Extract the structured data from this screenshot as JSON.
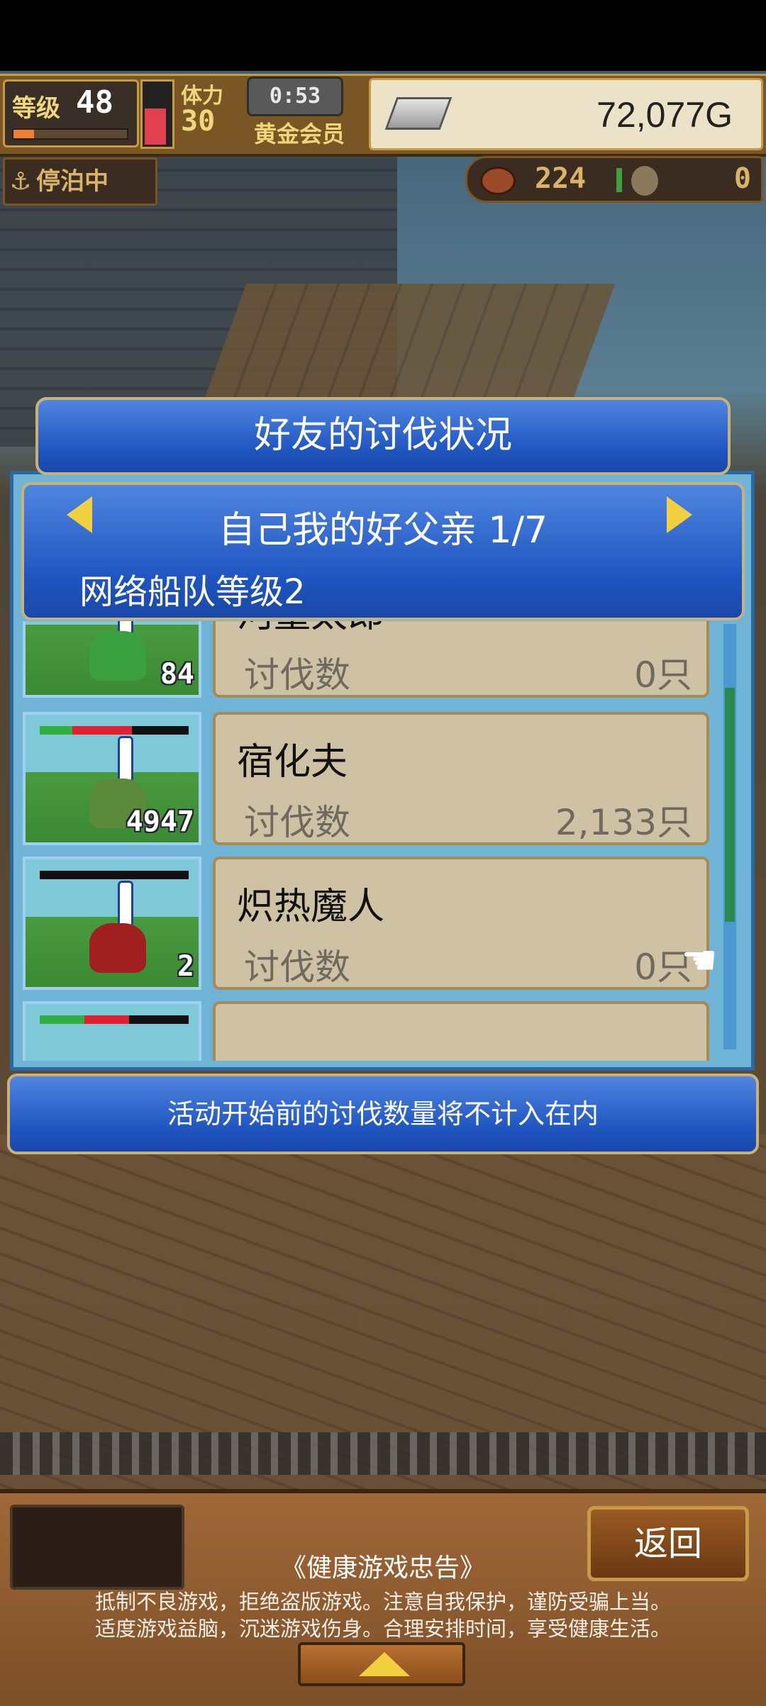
{
  "hud": {
    "level_label": "等级",
    "level": "48",
    "stamina_label": "体力",
    "stamina": "30",
    "timer": "0:53",
    "membership": "黄金会员",
    "gold": "72,077G"
  },
  "status": {
    "moored": "停泊中",
    "resource1": "224",
    "resource2": "0"
  },
  "dialog": {
    "title": "好友的讨伐状况",
    "friend_name": "自己我的好父亲 1/7",
    "fleet_level": "网络船队等级2",
    "rows": [
      {
        "name": "河童太郎",
        "label": "讨伐数",
        "value": "0只",
        "thumb_count": "84",
        "sprite_color": "#3aa040"
      },
      {
        "name": "宿化夫",
        "label": "讨伐数",
        "value": "2,133只",
        "thumb_count": "4947",
        "sprite_color": "#5a8a3a"
      },
      {
        "name": "炽热魔人",
        "label": "讨伐数",
        "value": "0只",
        "thumb_count": "2",
        "sprite_color": "#a02020"
      }
    ],
    "notice": "活动开始前的讨伐数量将不计入在内"
  },
  "footer": {
    "back": "返回",
    "health_title": "《健康游戏忠告》",
    "health_line1": "抵制不良游戏，拒绝盗版游戏。注意自我保护，谨防受骗上当。",
    "health_line2": "适度游戏益脑，沉迷游戏伤身。合理安排时间，享受健康生活。"
  }
}
